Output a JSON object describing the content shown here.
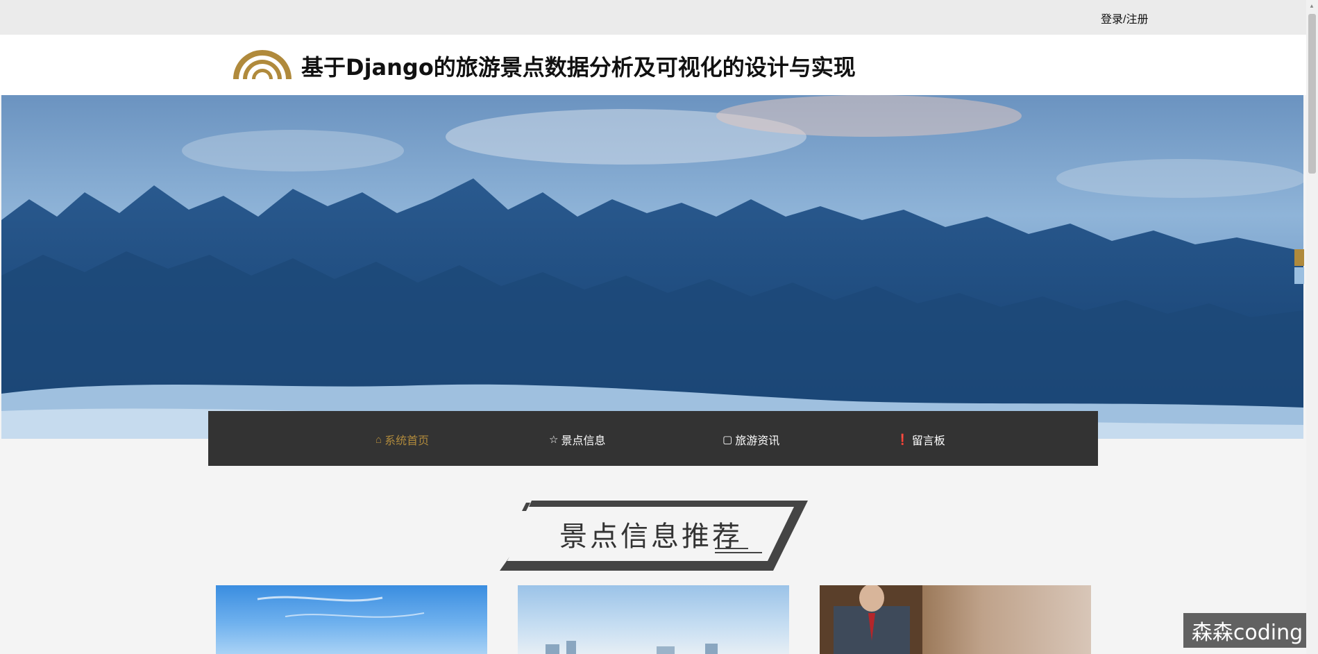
{
  "topbar": {
    "login_label": "登录/注册"
  },
  "header": {
    "site_title": "基于Django的旅游景点数据分析及可视化的设计与实现"
  },
  "nav": {
    "items": [
      {
        "label": "系统首页",
        "icon": "home-icon",
        "glyph": "⌂",
        "active": true
      },
      {
        "label": "景点信息",
        "icon": "star-icon",
        "glyph": "☆",
        "active": false
      },
      {
        "label": "旅游资讯",
        "icon": "bag-icon",
        "glyph": "▢",
        "active": false
      },
      {
        "label": "留言板",
        "icon": "alert-circle-icon",
        "glyph": "❗",
        "active": false
      }
    ]
  },
  "section": {
    "title": "景点信息推荐"
  },
  "watermark": {
    "text": "森森coding"
  },
  "colors": {
    "accent": "#b08a3c",
    "navbar": "#333333",
    "topbar": "#ebebeb"
  }
}
